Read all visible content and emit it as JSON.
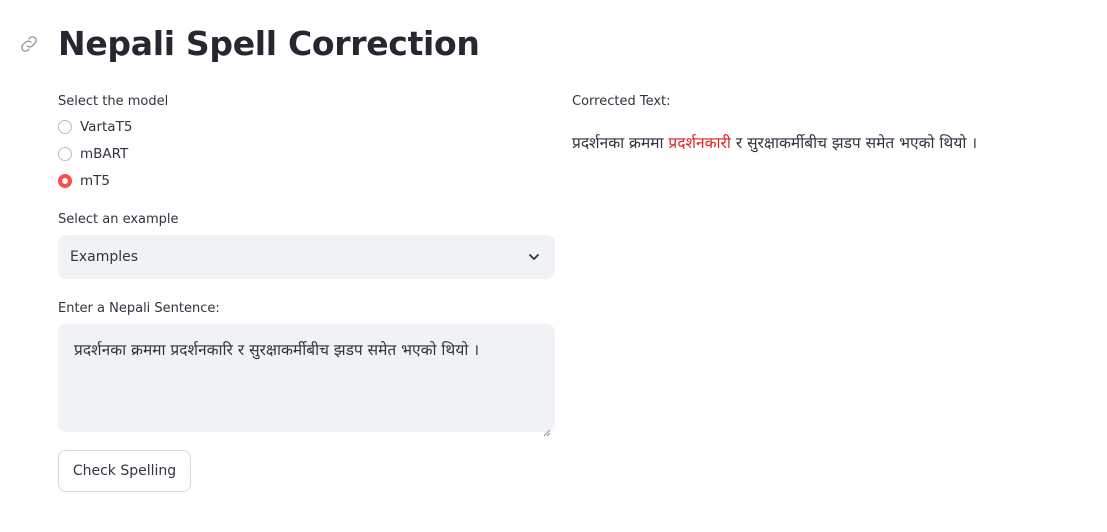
{
  "header": {
    "title": "Nepali Spell Correction",
    "icon": "link-icon"
  },
  "model_select": {
    "label": "Select the model",
    "options": [
      "VartaT5",
      "mBART",
      "mT5"
    ],
    "selected": "mT5"
  },
  "example_select": {
    "label": "Select an example",
    "value": "Examples"
  },
  "sentence_input": {
    "label": "Enter a Nepali Sentence:",
    "value": "प्रदर्शनका क्रममा प्रदर्शनकारि र सुरक्षाकर्मीबीच झडप समेत भएको थियो ।"
  },
  "check_button": {
    "label": "Check Spelling"
  },
  "output": {
    "label": "Corrected Text:",
    "prefix": "प्रदर्शनका क्रममा ",
    "corrected_word": "प्रदर्शनकारी",
    "suffix": " र सुरक्षाकर्मीबीच झडप समेत भएको थियो ।"
  },
  "colors": {
    "accent": "#ff4b4b",
    "highlight": "#e02020",
    "input_bg": "#f0f2f6"
  }
}
